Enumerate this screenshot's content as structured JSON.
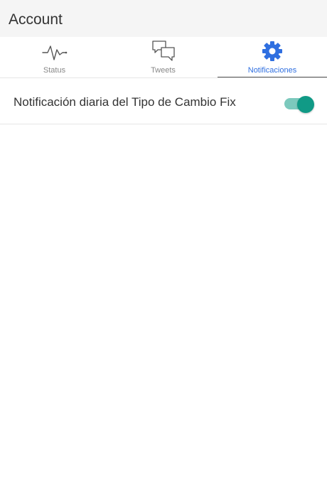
{
  "header": {
    "title": "Account"
  },
  "tabs": [
    {
      "label": "Status",
      "icon": "heartbeat-icon",
      "selected": false
    },
    {
      "label": "Tweets",
      "icon": "chat-bubbles-icon",
      "selected": false
    },
    {
      "label": "Notificaciones",
      "icon": "gear-icon",
      "selected": true
    }
  ],
  "settings": [
    {
      "label": "Notificación diaria del Tipo de Cambio Fix",
      "toggle_on": true
    }
  ],
  "colors": {
    "header_bg": "#f5f5f5",
    "active_tab": "#2f6fe0",
    "tab_label": "#888888",
    "toggle_track": "#7cc9bd",
    "toggle_knob": "#109a86"
  }
}
